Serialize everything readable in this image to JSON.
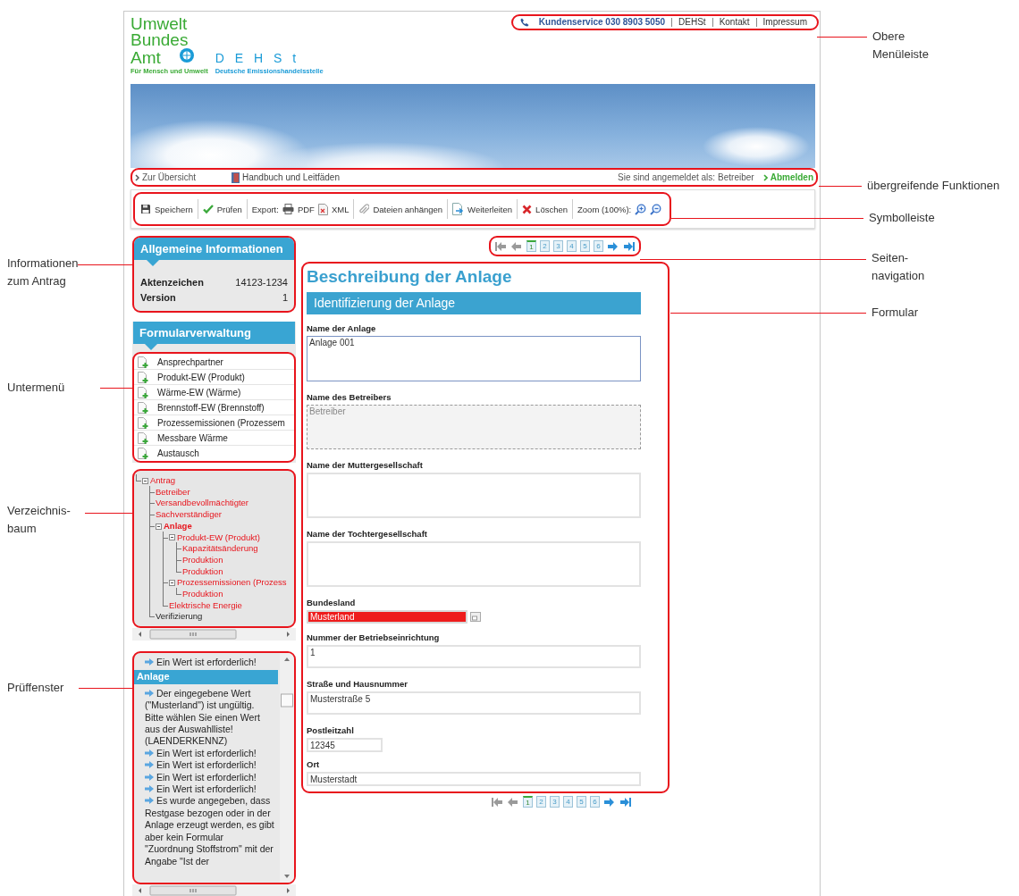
{
  "header": {
    "logo_lines": [
      "Umwelt",
      "Bundes",
      "Amt"
    ],
    "logo_tagline": "Für Mensch und Umwelt",
    "dehst_letters": "D E H S t",
    "dehst_subtitle": "Deutsche Emissionshandelsstelle"
  },
  "top_menu": {
    "service": "Kundenservice 030 8903 5050",
    "links": [
      "DEHSt",
      "Kontakt",
      "Impressum"
    ]
  },
  "nav_bar": {
    "overview": "Zur Übersicht",
    "manual": "Handbuch und Leitfäden",
    "login_label": "Sie sind angemeldet als:",
    "login_role": "Betreiber",
    "logout": "Abmelden"
  },
  "toolbar": {
    "groups": [
      {
        "items": [
          {
            "kind": "button",
            "label": "Speichern"
          }
        ]
      },
      {
        "items": [
          {
            "kind": "button",
            "label": "Prüfen"
          }
        ]
      },
      {
        "items": [
          {
            "kind": "text",
            "label": "Export:"
          },
          {
            "kind": "button",
            "label": "PDF"
          },
          {
            "kind": "button",
            "label": "XML"
          }
        ]
      },
      {
        "items": [
          {
            "kind": "button",
            "label": "Dateien anhängen"
          }
        ]
      },
      {
        "items": [
          {
            "kind": "button",
            "label": "Weiterleiten"
          }
        ]
      },
      {
        "items": [
          {
            "kind": "button",
            "label": "Löschen"
          }
        ]
      },
      {
        "items": [
          {
            "kind": "text",
            "label": "Zoom (100%):"
          },
          {
            "kind": "icon-button"
          },
          {
            "kind": "icon-button"
          }
        ]
      }
    ]
  },
  "general_info": {
    "title": "Allgemeine Informationen",
    "rows": [
      {
        "label": "Aktenzeichen",
        "value": "14123-1234"
      },
      {
        "label": "Version",
        "value": "1"
      }
    ]
  },
  "form_management": {
    "title": "Formularverwaltung",
    "items": [
      "Ansprechpartner",
      "Produkt-EW (Produkt)",
      "Wärme-EW (Wärme)",
      "Brennstoff-EW (Brennstoff)",
      "Prozessemissionen (Prozessem",
      "Messbare Wärme",
      "Austausch"
    ]
  },
  "tree": {
    "items": [
      {
        "label": "Antrag",
        "invalid": true,
        "selected": false,
        "expanded": true,
        "children": [
          {
            "label": "Betreiber",
            "invalid": true,
            "selected": false
          },
          {
            "label": "Versandbevollmächtigter",
            "invalid": true,
            "selected": false
          },
          {
            "label": "Sachverständiger",
            "invalid": true,
            "selected": false
          },
          {
            "label": "Anlage",
            "invalid": true,
            "selected": true,
            "expanded": true,
            "children": [
              {
                "label": "Produkt-EW (Produkt)",
                "invalid": true,
                "selected": false,
                "expanded": true,
                "children": [
                  {
                    "label": "Kapazitätsänderung",
                    "invalid": true,
                    "selected": false
                  },
                  {
                    "label": "Produktion",
                    "invalid": true,
                    "selected": false
                  },
                  {
                    "label": "Produktion",
                    "invalid": true,
                    "selected": false
                  }
                ]
              },
              {
                "label": "Prozessemissionen (Prozess",
                "invalid": true,
                "selected": false,
                "expanded": true,
                "children": [
                  {
                    "label": "Produktion",
                    "invalid": true,
                    "selected": false
                  }
                ]
              },
              {
                "label": "Elektrische Energie",
                "invalid": true,
                "selected": false
              }
            ]
          },
          {
            "label": "Verifizierung",
            "invalid": false,
            "selected": false
          }
        ]
      }
    ]
  },
  "check_window": {
    "entries": [
      {
        "kind": "message",
        "text": "Ein Wert ist erforderlich!"
      },
      {
        "kind": "heading",
        "text": "Anlage"
      },
      {
        "kind": "message",
        "text": "Der eingegebene Wert (\"Musterland\") ist ungültig. Bitte wählen Sie einen Wert aus der Auswahlliste! (LAENDERKENNZ)"
      },
      {
        "kind": "message",
        "text": "Ein Wert ist erforderlich!"
      },
      {
        "kind": "message",
        "text": "Ein Wert ist erforderlich!"
      },
      {
        "kind": "message",
        "text": "Ein Wert ist erforderlich!"
      },
      {
        "kind": "message",
        "text": "Ein Wert ist erforderlich!"
      },
      {
        "kind": "message",
        "text": "Es wurde angegeben, dass Restgase bezogen oder in der Anlage erzeugt werden, es gibt aber kein Formular \"Zuordnung Stoffstrom\" mit der Angabe \"Ist der"
      }
    ]
  },
  "page_nav_top": {
    "arrows": [
      {
        "kind": "first",
        "disabled": true
      },
      {
        "kind": "prev",
        "disabled": true
      },
      {
        "kind": "next",
        "disabled": false
      },
      {
        "kind": "last",
        "disabled": false
      }
    ],
    "pages": [
      {
        "label": "1",
        "selected": true
      },
      {
        "label": "2",
        "selected": false
      },
      {
        "label": "3",
        "selected": false
      },
      {
        "label": "4",
        "selected": false
      },
      {
        "label": "5",
        "selected": false
      },
      {
        "label": "6",
        "selected": false
      }
    ]
  },
  "form": {
    "title": "Beschreibung der Anlage",
    "section": "Identifizierung der Anlage",
    "fields": [
      {
        "kind": "textarea",
        "label": "Name der Anlage",
        "value": "Anlage 001",
        "focused": true
      },
      {
        "kind": "readonly",
        "label": "Name des Betreibers",
        "value": "Betreiber"
      },
      {
        "kind": "textarea",
        "label": "Name der Muttergesellschaft",
        "focused": false
      },
      {
        "kind": "textarea",
        "label": "Name der Tochtergesellschaft",
        "focused": false
      },
      {
        "kind": "select",
        "label": "Bundesland",
        "value": "Musterland",
        "invalid": true
      },
      {
        "kind": "input",
        "label": "Nummer der Betriebseinrichtung",
        "value": "1"
      },
      {
        "kind": "input",
        "label": "Straße und Hausnummer",
        "value": "Musterstraße 5"
      },
      {
        "kind": "short-input",
        "label": "Postleitzahl",
        "value": "12345"
      },
      {
        "kind": "line-input",
        "label": "Ort",
        "value": "Musterstadt"
      }
    ]
  },
  "page_nav_bottom": {
    "arrows": [
      {
        "kind": "first",
        "disabled": true
      },
      {
        "kind": "prev",
        "disabled": true
      },
      {
        "kind": "next",
        "disabled": false
      },
      {
        "kind": "last",
        "disabled": false
      }
    ],
    "pages": [
      {
        "label": "1",
        "selected": true
      },
      {
        "label": "2",
        "selected": false
      },
      {
        "label": "3",
        "selected": false
      },
      {
        "label": "4",
        "selected": false
      },
      {
        "label": "5",
        "selected": false
      },
      {
        "label": "6",
        "selected": false
      }
    ]
  },
  "annotations_left": [
    {
      "lines": [
        "Informationen",
        "zum Antrag"
      ]
    },
    {
      "lines": [
        "Untermenü"
      ]
    },
    {
      "lines": [
        "Verzeichnis-",
        "baum"
      ]
    },
    {
      "lines": [
        "Prüffenster"
      ]
    }
  ],
  "annotations_right": [
    {
      "lines": [
        "Obere",
        "Menüleiste"
      ]
    },
    {
      "lines": [
        "übergreifende Funktionen"
      ]
    },
    {
      "lines": [
        "Symbolleiste"
      ]
    },
    {
      "lines": [
        "Seiten-",
        "navigation"
      ]
    },
    {
      "lines": [
        "Formular"
      ]
    }
  ]
}
